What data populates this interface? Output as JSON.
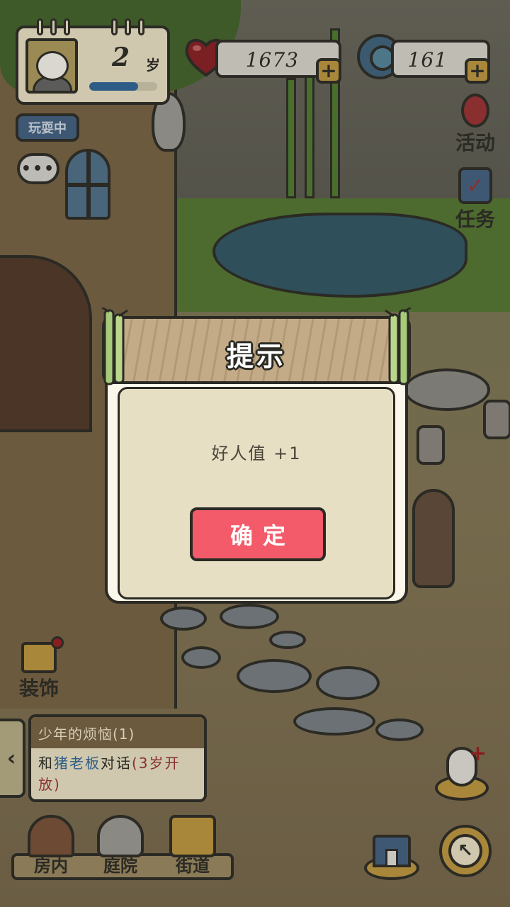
{
  "hud": {
    "age_number": "2",
    "age_unit": "岁",
    "age_progress_pct": 72,
    "status_label": "玩耍中",
    "chat_label": "•••",
    "hearts_value": "1673",
    "coins_value": "161",
    "plus_label": "+"
  },
  "side_menu": {
    "events_label": "活动",
    "tasks_label": "任务",
    "decorate_label": "装饰"
  },
  "quest": {
    "title": "少年的烦恼(1)",
    "prefix": "和",
    "npc": "猪老板",
    "action": "对话",
    "unlock": "(3岁开放)",
    "arrow": "‹"
  },
  "nav": {
    "items": [
      {
        "label": "房内",
        "icon": "door-icon"
      },
      {
        "label": "庭院",
        "icon": "yard-icon"
      },
      {
        "label": "街道",
        "icon": "street-icon"
      }
    ],
    "return_glyph": "↖"
  },
  "dialog": {
    "title": "提示",
    "message": "好人值 +1",
    "confirm_label": "确定"
  },
  "colors": {
    "confirm": "#f35b6a",
    "card": "#e7dfc4",
    "header_wood": "#c4ab87",
    "outline": "#2b2a24"
  }
}
